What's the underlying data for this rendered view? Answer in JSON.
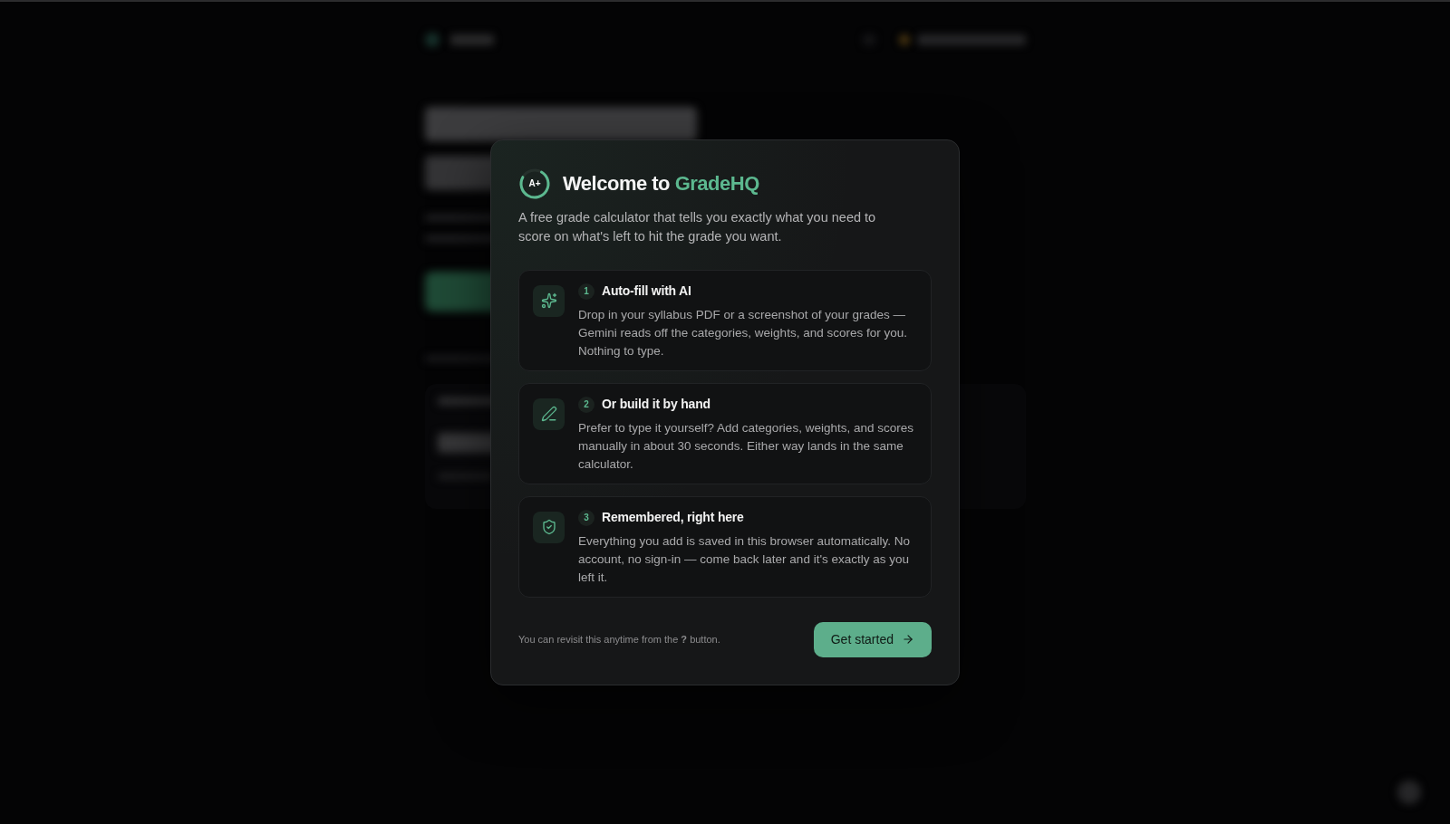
{
  "dialog": {
    "logo": {
      "text": "A+"
    },
    "title": {
      "prefix": "Welcome to",
      "brand": "GradeHQ"
    },
    "description": "A free grade calculator that tells you exactly what you need to score on what's left to hit the grade you want.",
    "steps": [
      {
        "kind": "autofill",
        "number": "1",
        "title": "Auto-fill with AI",
        "body": "Drop in your syllabus PDF or a screenshot of your grades — Gemini reads off the categories, weights, and scores for you. Nothing to type."
      },
      {
        "kind": "manual",
        "number": "2",
        "title": "Or build it by hand",
        "body": "Prefer to type it yourself? Add categories, weights, and scores manually in about 30 seconds. Either way lands in the same calculator."
      },
      {
        "kind": "storage",
        "number": "3",
        "title": "Remembered, right here",
        "body": "Everything you add is saved in this browser automatically. No account, no sign-in — come back later and it's exactly as you left it."
      }
    ],
    "footer_note": "You can revisit this anytime from the **?** button.",
    "primary_button": {
      "label": "Get started"
    }
  }
}
